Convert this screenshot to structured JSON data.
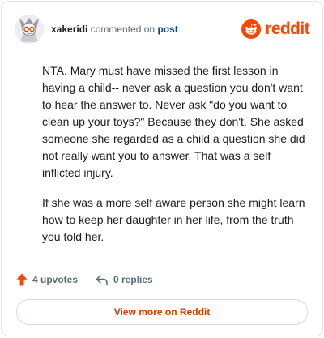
{
  "header": {
    "username": "xakeridi",
    "action_text": "commented on",
    "post_link": "post",
    "brand": "reddit"
  },
  "comment": {
    "paragraphs": [
      "NTA. Mary must have missed the first lesson in having a child-- never ask a question you don't want to hear the answer to. Never ask \"do you want to clean up your toys?\" Because they don't. She asked someone she regarded as a child a question she did not really want you to answer. That was a self inflicted injury.",
      "If she was a more self aware person she might learn how to keep her daughter in her life, from the truth you told her."
    ]
  },
  "footer": {
    "upvotes": "4 upvotes",
    "replies": "0 replies"
  },
  "cta": {
    "label": "View more on Reddit"
  },
  "colors": {
    "brand": "#ff4500",
    "upvote": "#ff4500",
    "link": "#0a449b",
    "muted": "#576f76",
    "cta_text": "#d93a00"
  },
  "icons": {
    "avatar": "user-avatar",
    "brand": "reddit-snoo-icon",
    "upvote": "upvote-arrow-icon",
    "reply": "reply-arrow-icon"
  }
}
